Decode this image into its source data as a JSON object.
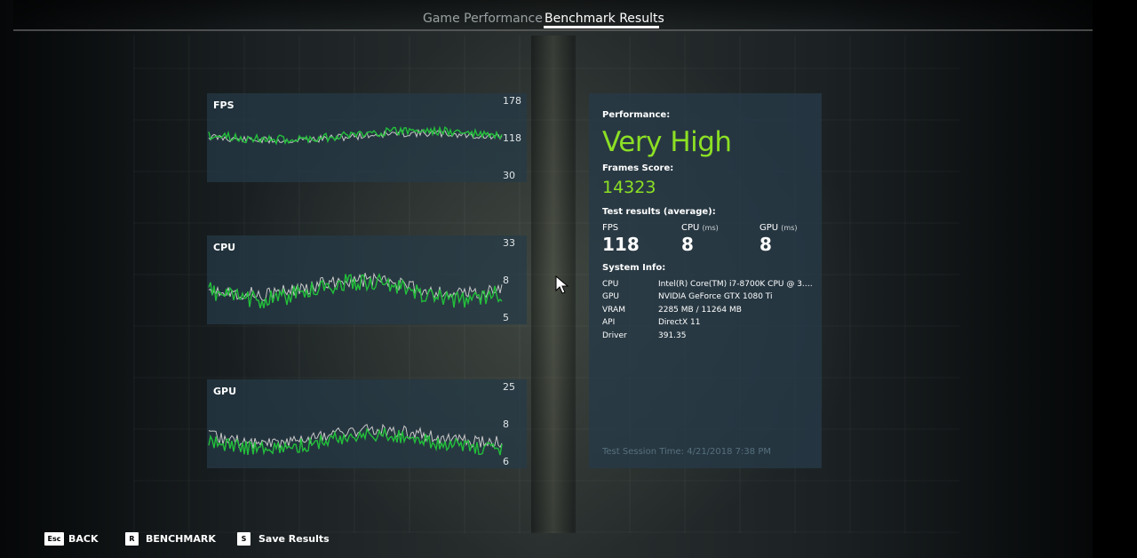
{
  "tabs": [
    {
      "label": "Game Performance",
      "active": false
    },
    {
      "label": "Benchmark Results",
      "active": true
    }
  ],
  "graphs": {
    "fps": {
      "title": "FPS",
      "ticks": {
        "top": "178",
        "mid": "118",
        "bottom": "30"
      }
    },
    "cpu": {
      "title": "CPU",
      "ticks": {
        "top": "33",
        "mid": "8",
        "bottom": "5"
      }
    },
    "gpu": {
      "title": "GPU",
      "ticks": {
        "top": "25",
        "mid": "8",
        "bottom": "6"
      }
    }
  },
  "results": {
    "performance_label": "Performance:",
    "performance_value": "Very High",
    "frames_score_label": "Frames Score:",
    "frames_score_value": "14323",
    "test_results_label": "Test results (average):",
    "metrics": [
      {
        "name": "FPS",
        "unit": "",
        "value": "118"
      },
      {
        "name": "CPU",
        "unit": "(ms)",
        "value": "8"
      },
      {
        "name": "GPU",
        "unit": "(ms)",
        "value": "8"
      }
    ],
    "system_info_label": "System Info:",
    "system_info": [
      {
        "key": "CPU",
        "value": "Intel(R) Core(TM) i7-8700K CPU @ 3.7..."
      },
      {
        "key": "GPU",
        "value": "NVIDIA GeForce GTX 1080 Ti"
      },
      {
        "key": "VRAM",
        "value": "2285 MB / 11264 MB"
      },
      {
        "key": "API",
        "value": "DirectX 11"
      },
      {
        "key": "Driver",
        "value": "391.35"
      }
    ],
    "session_time": "Test Session Time: 4/21/2018 7:38 PM"
  },
  "bottom_bar": [
    {
      "key": "Esc",
      "label": "BACK"
    },
    {
      "key": "R",
      "label": "BENCHMARK"
    },
    {
      "key": "S",
      "label": "Save Results"
    }
  ],
  "colors": {
    "accent_green": "#8ce024",
    "series_green": "#22c03a",
    "series_white": "#c8c8c8",
    "panel": "#263a48"
  },
  "icons": [
    "mouse-cursor-icon"
  ]
}
